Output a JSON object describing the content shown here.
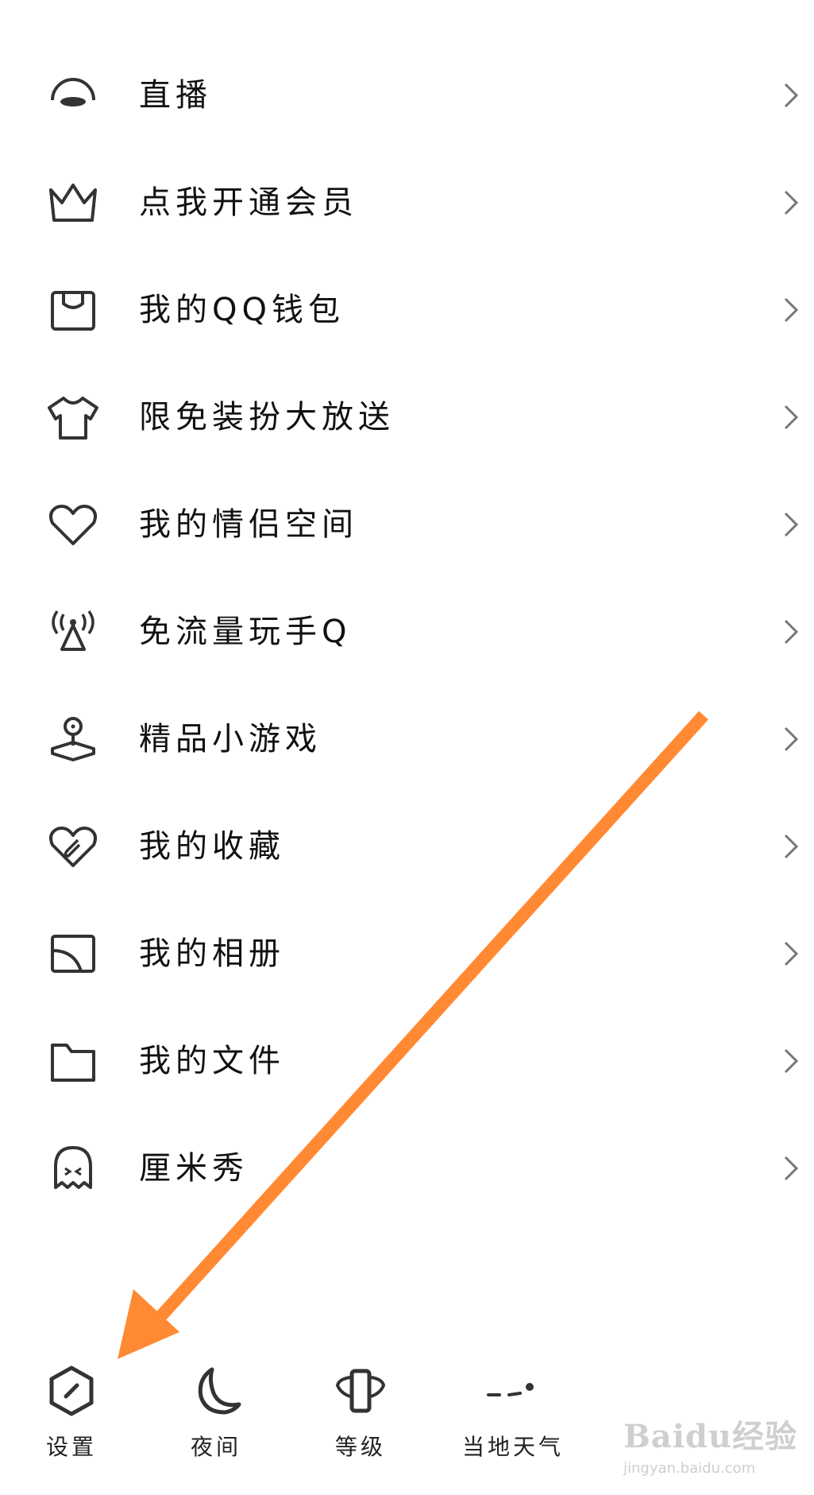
{
  "menu": {
    "items": [
      {
        "icon": "live-icon",
        "label": "直播"
      },
      {
        "icon": "crown-icon",
        "label": "点我开通会员"
      },
      {
        "icon": "wallet-icon",
        "label": "我的QQ钱包"
      },
      {
        "icon": "tshirt-icon",
        "label": "限免装扮大放送"
      },
      {
        "icon": "heart-icon",
        "label": "我的情侣空间"
      },
      {
        "icon": "signal-tower-icon",
        "label": "免流量玩手Q"
      },
      {
        "icon": "joystick-icon",
        "label": "精品小游戏"
      },
      {
        "icon": "favorite-heart-icon",
        "label": "我的收藏"
      },
      {
        "icon": "album-icon",
        "label": "我的相册"
      },
      {
        "icon": "folder-icon",
        "label": "我的文件"
      },
      {
        "icon": "avatar-ghost-icon",
        "label": "厘米秀"
      }
    ]
  },
  "bottom_bar": {
    "items": [
      {
        "icon": "settings-hexagon-icon",
        "label": "设置"
      },
      {
        "icon": "moon-icon",
        "label": "夜间"
      },
      {
        "icon": "level-badge-icon",
        "label": "等级"
      },
      {
        "icon": "weather-icon",
        "label": "当地天气"
      }
    ]
  },
  "annotation": {
    "arrow_color": "#ff8a33"
  },
  "watermark": {
    "logo": "Baidu经验",
    "url": "jingyan.baidu.com"
  }
}
